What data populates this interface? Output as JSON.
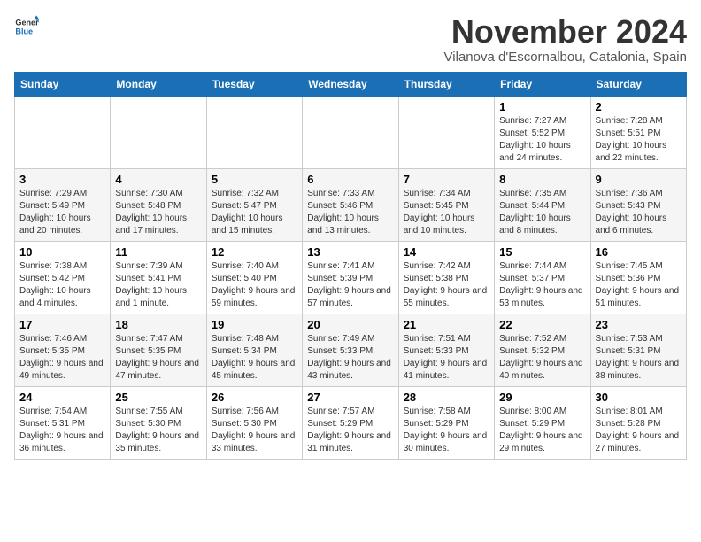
{
  "logo": {
    "line1": "General",
    "line2": "Blue"
  },
  "title": "November 2024",
  "location": "Vilanova d'Escornalbou, Catalonia, Spain",
  "days_of_week": [
    "Sunday",
    "Monday",
    "Tuesday",
    "Wednesday",
    "Thursday",
    "Friday",
    "Saturday"
  ],
  "weeks": [
    [
      {
        "day": "",
        "info": ""
      },
      {
        "day": "",
        "info": ""
      },
      {
        "day": "",
        "info": ""
      },
      {
        "day": "",
        "info": ""
      },
      {
        "day": "",
        "info": ""
      },
      {
        "day": "1",
        "info": "Sunrise: 7:27 AM\nSunset: 5:52 PM\nDaylight: 10 hours and 24 minutes."
      },
      {
        "day": "2",
        "info": "Sunrise: 7:28 AM\nSunset: 5:51 PM\nDaylight: 10 hours and 22 minutes."
      }
    ],
    [
      {
        "day": "3",
        "info": "Sunrise: 7:29 AM\nSunset: 5:49 PM\nDaylight: 10 hours and 20 minutes."
      },
      {
        "day": "4",
        "info": "Sunrise: 7:30 AM\nSunset: 5:48 PM\nDaylight: 10 hours and 17 minutes."
      },
      {
        "day": "5",
        "info": "Sunrise: 7:32 AM\nSunset: 5:47 PM\nDaylight: 10 hours and 15 minutes."
      },
      {
        "day": "6",
        "info": "Sunrise: 7:33 AM\nSunset: 5:46 PM\nDaylight: 10 hours and 13 minutes."
      },
      {
        "day": "7",
        "info": "Sunrise: 7:34 AM\nSunset: 5:45 PM\nDaylight: 10 hours and 10 minutes."
      },
      {
        "day": "8",
        "info": "Sunrise: 7:35 AM\nSunset: 5:44 PM\nDaylight: 10 hours and 8 minutes."
      },
      {
        "day": "9",
        "info": "Sunrise: 7:36 AM\nSunset: 5:43 PM\nDaylight: 10 hours and 6 minutes."
      }
    ],
    [
      {
        "day": "10",
        "info": "Sunrise: 7:38 AM\nSunset: 5:42 PM\nDaylight: 10 hours and 4 minutes."
      },
      {
        "day": "11",
        "info": "Sunrise: 7:39 AM\nSunset: 5:41 PM\nDaylight: 10 hours and 1 minute."
      },
      {
        "day": "12",
        "info": "Sunrise: 7:40 AM\nSunset: 5:40 PM\nDaylight: 9 hours and 59 minutes."
      },
      {
        "day": "13",
        "info": "Sunrise: 7:41 AM\nSunset: 5:39 PM\nDaylight: 9 hours and 57 minutes."
      },
      {
        "day": "14",
        "info": "Sunrise: 7:42 AM\nSunset: 5:38 PM\nDaylight: 9 hours and 55 minutes."
      },
      {
        "day": "15",
        "info": "Sunrise: 7:44 AM\nSunset: 5:37 PM\nDaylight: 9 hours and 53 minutes."
      },
      {
        "day": "16",
        "info": "Sunrise: 7:45 AM\nSunset: 5:36 PM\nDaylight: 9 hours and 51 minutes."
      }
    ],
    [
      {
        "day": "17",
        "info": "Sunrise: 7:46 AM\nSunset: 5:35 PM\nDaylight: 9 hours and 49 minutes."
      },
      {
        "day": "18",
        "info": "Sunrise: 7:47 AM\nSunset: 5:35 PM\nDaylight: 9 hours and 47 minutes."
      },
      {
        "day": "19",
        "info": "Sunrise: 7:48 AM\nSunset: 5:34 PM\nDaylight: 9 hours and 45 minutes."
      },
      {
        "day": "20",
        "info": "Sunrise: 7:49 AM\nSunset: 5:33 PM\nDaylight: 9 hours and 43 minutes."
      },
      {
        "day": "21",
        "info": "Sunrise: 7:51 AM\nSunset: 5:33 PM\nDaylight: 9 hours and 41 minutes."
      },
      {
        "day": "22",
        "info": "Sunrise: 7:52 AM\nSunset: 5:32 PM\nDaylight: 9 hours and 40 minutes."
      },
      {
        "day": "23",
        "info": "Sunrise: 7:53 AM\nSunset: 5:31 PM\nDaylight: 9 hours and 38 minutes."
      }
    ],
    [
      {
        "day": "24",
        "info": "Sunrise: 7:54 AM\nSunset: 5:31 PM\nDaylight: 9 hours and 36 minutes."
      },
      {
        "day": "25",
        "info": "Sunrise: 7:55 AM\nSunset: 5:30 PM\nDaylight: 9 hours and 35 minutes."
      },
      {
        "day": "26",
        "info": "Sunrise: 7:56 AM\nSunset: 5:30 PM\nDaylight: 9 hours and 33 minutes."
      },
      {
        "day": "27",
        "info": "Sunrise: 7:57 AM\nSunset: 5:29 PM\nDaylight: 9 hours and 31 minutes."
      },
      {
        "day": "28",
        "info": "Sunrise: 7:58 AM\nSunset: 5:29 PM\nDaylight: 9 hours and 30 minutes."
      },
      {
        "day": "29",
        "info": "Sunrise: 8:00 AM\nSunset: 5:29 PM\nDaylight: 9 hours and 29 minutes."
      },
      {
        "day": "30",
        "info": "Sunrise: 8:01 AM\nSunset: 5:28 PM\nDaylight: 9 hours and 27 minutes."
      }
    ]
  ]
}
